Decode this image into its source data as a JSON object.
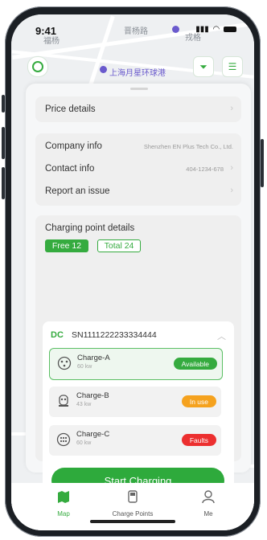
{
  "status_bar": {
    "time": "9:41"
  },
  "map": {
    "labels": [
      "晋杨路",
      "福杨",
      "戎格",
      "上海月星环球港"
    ]
  },
  "price": {
    "label": "Price details"
  },
  "company": {
    "company_label": "Company info",
    "company_value": "Shenzhen EN Plus Tech Co., Ltd.",
    "contact_label": "Contact info",
    "contact_value": "404-1234-678",
    "report_label": "Report an issue"
  },
  "charging": {
    "title": "Charging point details",
    "free_label": "Free 12",
    "total_label": "Total 24",
    "type": "DC",
    "serial": "SN1111222233334444",
    "chargers": [
      {
        "name": "Charge-A",
        "power": "60 kw",
        "status": "Available",
        "status_color": "#35ab3f"
      },
      {
        "name": "Charge-B",
        "power": "43 kw",
        "status": "In use",
        "status_color": "#f5a21e"
      },
      {
        "name": "Charge-C",
        "power": "60 kw",
        "status": "Faults",
        "status_color": "#ec2f2f"
      }
    ],
    "start_label": "Start Charging"
  },
  "tabs": [
    {
      "label": "Map",
      "icon": "map-icon"
    },
    {
      "label": "Charge Points",
      "icon": "charge-point-icon"
    },
    {
      "label": "Me",
      "icon": "user-icon"
    }
  ],
  "colors": {
    "accent": "#2eaa3c",
    "active_tab": "#35ab3f"
  }
}
